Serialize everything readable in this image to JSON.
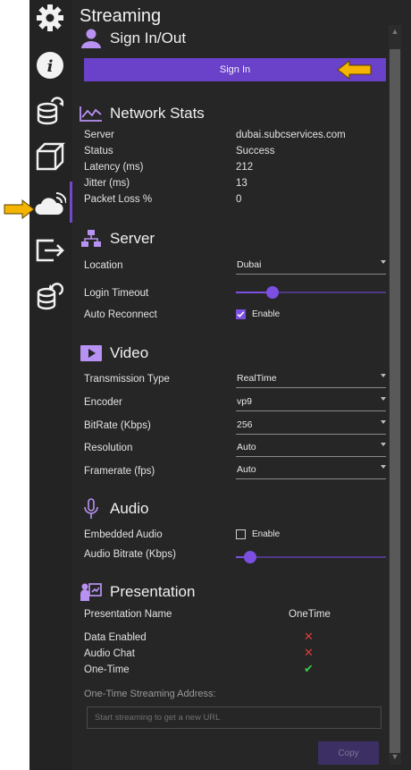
{
  "header": {
    "title": "Streaming"
  },
  "signin": {
    "heading": "Sign In/Out",
    "button_label": "Sign In"
  },
  "network": {
    "heading": "Network Stats",
    "rows": [
      {
        "label": "Server",
        "value": "dubai.subcservices.com"
      },
      {
        "label": "Status",
        "value": "Success"
      },
      {
        "label": "Latency (ms)",
        "value": "212"
      },
      {
        "label": "Jitter (ms)",
        "value": "13"
      },
      {
        "label": "Packet Loss %",
        "value": "0"
      }
    ]
  },
  "server": {
    "heading": "Server",
    "location_label": "Location",
    "location_value": "Dubai",
    "login_timeout_label": "Login Timeout",
    "login_timeout_level": 0.22,
    "auto_reconnect_label": "Auto Reconnect",
    "auto_reconnect_checked": true,
    "auto_reconnect_option": "Enable"
  },
  "video": {
    "heading": "Video",
    "rows": [
      {
        "label": "Transmission Type",
        "value": "RealTime"
      },
      {
        "label": "Encoder",
        "value": "vp9"
      },
      {
        "label": "BitRate (Kbps)",
        "value": "256"
      },
      {
        "label": "Resolution",
        "value": "Auto"
      },
      {
        "label": "Framerate (fps)",
        "value": "Auto"
      }
    ]
  },
  "audio": {
    "heading": "Audio",
    "embedded_label": "Embedded Audio",
    "embedded_checked": false,
    "embedded_option": "Enable",
    "bitrate_label": "Audio Bitrate (Kbps)",
    "bitrate_level": 0.06
  },
  "presentation": {
    "heading": "Presentation",
    "name_label": "Presentation Name",
    "name_value": "OneTime",
    "flags": [
      {
        "label": "Data Enabled",
        "status": "x"
      },
      {
        "label": "Audio Chat",
        "status": "x"
      },
      {
        "label": "One-Time",
        "status": "check"
      }
    ],
    "ota_label": "One-Time Streaming Address:",
    "ota_placeholder": "Start streaming to get a new URL",
    "copy_label": "Copy"
  },
  "rail": {
    "icons": [
      "settings-gear-icon",
      "info-icon",
      "database-upload-icon",
      "cube-icon",
      "cloud-streaming-icon",
      "export-icon",
      "database-sync-icon"
    ],
    "selected": "cloud-streaming-icon"
  },
  "colors": {
    "accent": "#6a41c9",
    "highlight_arrow": "#f4b400",
    "error": "#e03a3a",
    "success": "#3cc84a"
  }
}
